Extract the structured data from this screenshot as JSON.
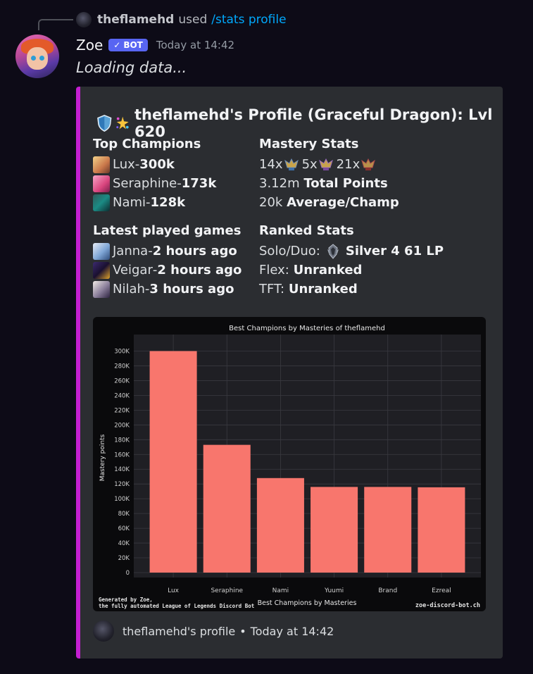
{
  "reply": {
    "user": "theflamehd",
    "used": "used",
    "command": "/stats profile"
  },
  "message": {
    "bot_name": "Zoe",
    "bot_tag": "BOT",
    "bot_tag_check": "✓",
    "timestamp": "Today at 14:42",
    "content": "Loading data..."
  },
  "embed": {
    "accent_color": "#c31fd1",
    "title": "theflamehd's Profile (Graceful Dragon): Lvl 620",
    "top_champions": {
      "title": "Top Champions",
      "items": [
        {
          "name": "Lux",
          "sep": " - ",
          "value": "300k"
        },
        {
          "name": "Seraphine",
          "sep": " - ",
          "value": "173k"
        },
        {
          "name": "Nami",
          "sep": " - ",
          "value": "128k"
        }
      ]
    },
    "mastery_stats": {
      "title": "Mastery Stats",
      "counts": [
        "14x",
        "5x",
        "21x"
      ],
      "total_value": "3.12m",
      "total_label": "Total Points",
      "avg_value": "20k",
      "avg_label": "Average/Champ"
    },
    "latest_games": {
      "title": "Latest played games",
      "items": [
        {
          "name": "Janna",
          "sep": " - ",
          "value": "2 hours ago"
        },
        {
          "name": "Veigar",
          "sep": " - ",
          "value": "2 hours ago"
        },
        {
          "name": "Nilah",
          "sep": " - ",
          "value": "3 hours ago"
        }
      ]
    },
    "ranked_stats": {
      "title": "Ranked Stats",
      "solo_label": "Solo/Duo:",
      "solo_value": "Silver 4 61 LP",
      "flex_label": "Flex:",
      "flex_value": "Unranked",
      "tft_label": "TFT:",
      "tft_value": "Unranked"
    },
    "footer": {
      "text": "theflamehd's profile",
      "sep": "•",
      "timestamp": "Today at 14:42"
    }
  },
  "chart_data": {
    "type": "bar",
    "title": "Best Champions by Masteries of theflamehd",
    "xlabel": "Best Champions by Masteries",
    "ylabel": "Mastery points",
    "categories": [
      "Lux",
      "Seraphine",
      "Nami",
      "Yuumi",
      "Brand",
      "Ezreal"
    ],
    "values": [
      300000,
      173000,
      128000,
      116000,
      116000,
      115500
    ],
    "ylim": [
      0,
      310000
    ],
    "yticks": [
      {
        "v": 0,
        "label": "0"
      },
      {
        "v": 20000,
        "label": "20K"
      },
      {
        "v": 40000,
        "label": "40K"
      },
      {
        "v": 60000,
        "label": "60K"
      },
      {
        "v": 80000,
        "label": "80K"
      },
      {
        "v": 100000,
        "label": "100K"
      },
      {
        "v": 120000,
        "label": "120K"
      },
      {
        "v": 140000,
        "label": "140K"
      },
      {
        "v": 160000,
        "label": "160K"
      },
      {
        "v": 180000,
        "label": "180K"
      },
      {
        "v": 200000,
        "label": "200K"
      },
      {
        "v": 220000,
        "label": "220K"
      },
      {
        "v": 240000,
        "label": "240K"
      },
      {
        "v": 260000,
        "label": "260K"
      },
      {
        "v": 280000,
        "label": "280K"
      },
      {
        "v": 300000,
        "label": "300K"
      }
    ],
    "bar_color": "#f8766d",
    "grid": true,
    "credit_line1": "Generated by Zoe,",
    "credit_line2": "the fully automated League of Legends Discord Bot",
    "site": "zoe-discord-bot.ch"
  }
}
